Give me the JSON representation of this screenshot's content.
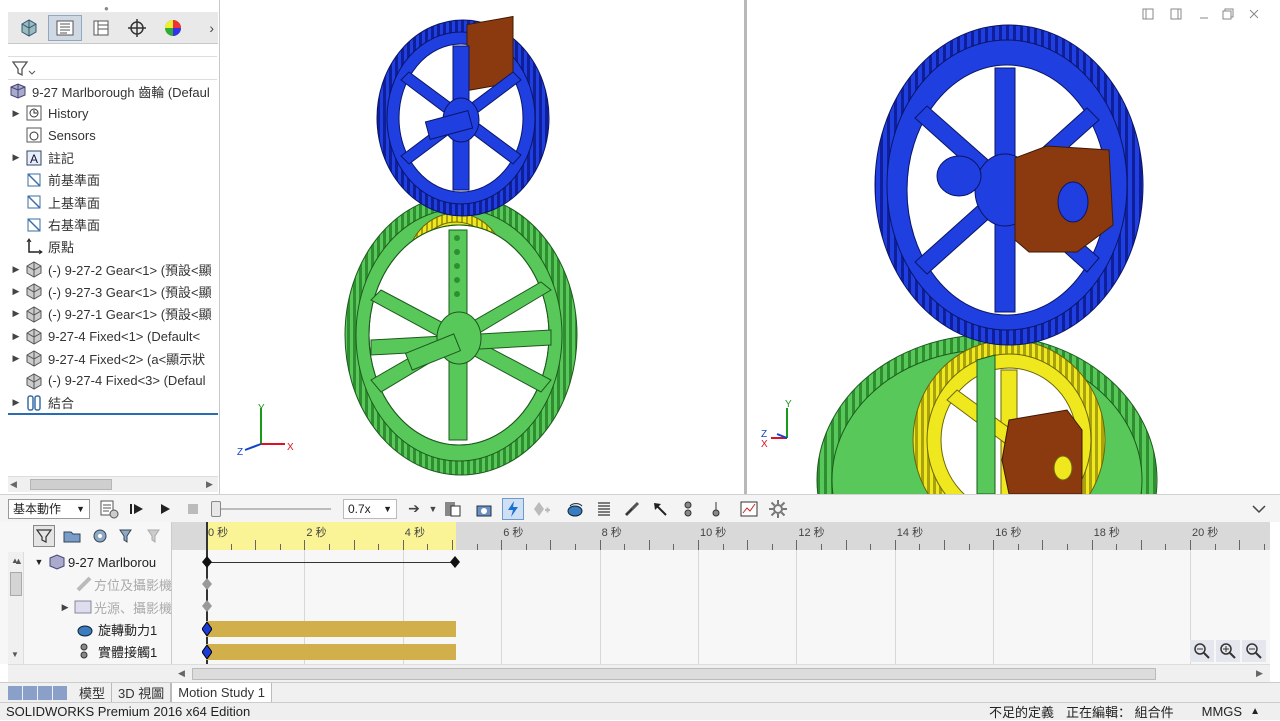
{
  "feature_tree": {
    "root_label": "9-27 Marlborough 齒輪  (Defaul",
    "items": [
      {
        "label": "History",
        "caret": true
      },
      {
        "label": "Sensors",
        "caret": false
      },
      {
        "label": "註記",
        "caret": true
      },
      {
        "label": "前基準面",
        "caret": false
      },
      {
        "label": "上基準面",
        "caret": false
      },
      {
        "label": "右基準面",
        "caret": false
      },
      {
        "label": "原點",
        "caret": false
      },
      {
        "label": "(-) 9-27-2 Gear<1> (預設<顯",
        "caret": true
      },
      {
        "label": "(-) 9-27-3 Gear<1> (預設<顯",
        "caret": true
      },
      {
        "label": "(-) 9-27-1 Gear<1> (預設<顯",
        "caret": true
      },
      {
        "label": "9-27-4 Fixed<1> (Default<",
        "caret": true
      },
      {
        "label": "9-27-4 Fixed<2> (a<顯示狀",
        "caret": true
      },
      {
        "label": "(-) 9-27-4 Fixed<3> (Defaul",
        "caret": false
      },
      {
        "label": "結合",
        "caret": true
      }
    ]
  },
  "viewports": {
    "left_axes": {
      "x": "X",
      "y": "Y",
      "z": "Z"
    },
    "right_axes": {
      "x": "X",
      "y": "Y",
      "z": "Z"
    }
  },
  "motion_toolbar": {
    "study_type": "基本動作",
    "playback_speed": "0.7x"
  },
  "motion_tree": {
    "items": [
      {
        "label": "9-27 Marlborou"
      },
      {
        "label": "方位及攝影機"
      },
      {
        "label": "光源、攝影機"
      },
      {
        "label": "旋轉動力1"
      },
      {
        "label": "實體接觸1"
      }
    ]
  },
  "timeline": {
    "ticks": [
      "0 秒",
      "2 秒",
      "4 秒",
      "6 秒",
      "8 秒",
      "10 秒",
      "12 秒",
      "14 秒",
      "16 秒",
      "18 秒",
      "20 秒"
    ]
  },
  "bottom_tabs": [
    "模型",
    "3D 視圖",
    "Motion Study 1"
  ],
  "status_bar": {
    "edition": "SOLIDWORKS Premium 2016 x64 Edition",
    "definition": "不足的定義",
    "editing": "正在編輯： 組合件",
    "units": "MMGS"
  },
  "colors": {
    "gear_blue": "#1f3fe0",
    "gear_green": "#59c85a",
    "gear_yellow": "#f0e81e",
    "fixed_brown": "#8b3a10",
    "timeline_bar": "#d1af4a",
    "timeline_highlight": "#fbf496"
  }
}
